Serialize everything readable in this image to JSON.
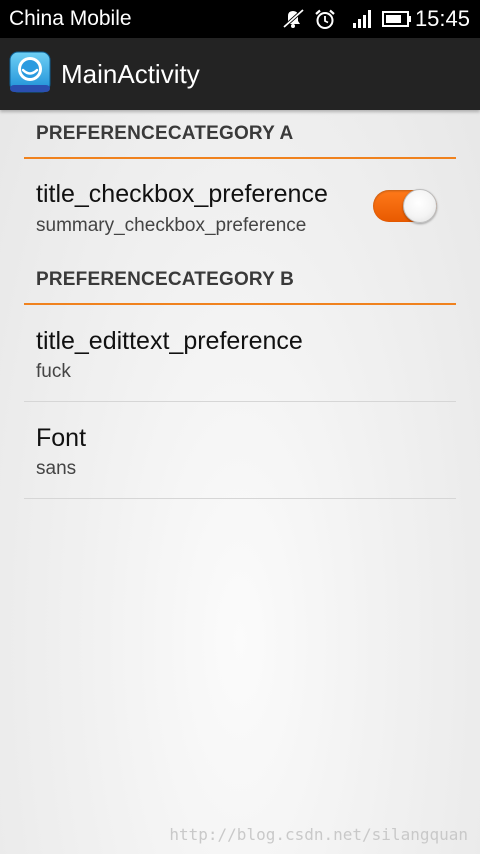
{
  "status_bar": {
    "carrier": "China Mobile",
    "time": "15:45",
    "icons": [
      "mute-icon",
      "alarm-icon",
      "signal-icon",
      "battery-icon"
    ]
  },
  "action_bar": {
    "title": "MainActivity",
    "icon": "app-face-icon"
  },
  "preferences": {
    "category_a": {
      "label": "PREFERENCECATEGORY A",
      "checkbox": {
        "title": "title_checkbox_preference",
        "summary": "summary_checkbox_preference",
        "checked": true
      }
    },
    "category_b": {
      "label": "PREFERENCECATEGORY B",
      "edittext": {
        "title": "title_edittext_preference",
        "summary": "fuck"
      },
      "font": {
        "title": "Font",
        "summary": "sans"
      }
    }
  },
  "watermark": "http://blog.csdn.net/silangquan",
  "colors": {
    "accent": "#f0821e",
    "toggle_on": "#f06a0a",
    "action_bar": "#232323",
    "status_bar": "#000000"
  }
}
